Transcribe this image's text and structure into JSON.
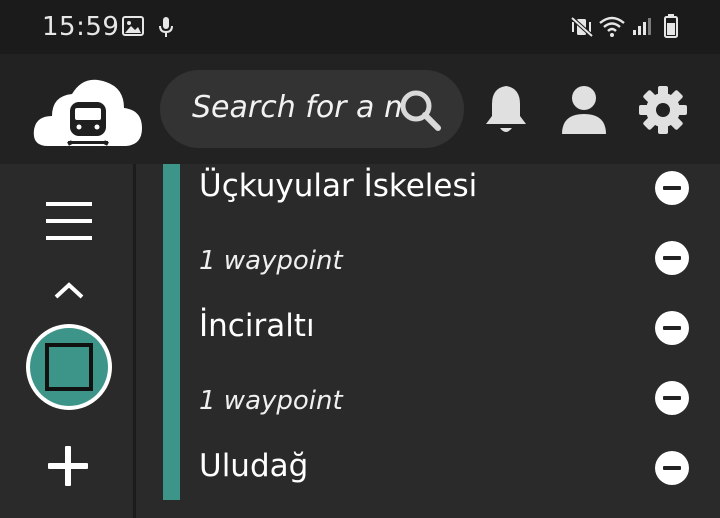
{
  "status_bar": {
    "time": "15:59",
    "icons": [
      "image-icon",
      "mic-icon",
      "vibrate-mute-icon",
      "wifi-icon",
      "signal-icon",
      "battery-icon"
    ]
  },
  "app_bar": {
    "search_placeholder": "Search for a ma",
    "icons": [
      "train-cloud-logo",
      "search-icon",
      "bell-icon",
      "user-icon",
      "gear-icon"
    ]
  },
  "left_rail": {
    "icons": [
      "menu-icon",
      "chevron-up-icon",
      "stop-square-icon",
      "plus-icon"
    ]
  },
  "route": {
    "accent_color": "#3d958a",
    "items": [
      {
        "label": "Üçkuyular İskelesi",
        "kind": "stop"
      },
      {
        "label": "1 waypoint",
        "kind": "waypoint"
      },
      {
        "label": "İnciraltı",
        "kind": "stop"
      },
      {
        "label": "1 waypoint",
        "kind": "waypoint"
      },
      {
        "label": "Uludağ",
        "kind": "stop"
      }
    ]
  }
}
